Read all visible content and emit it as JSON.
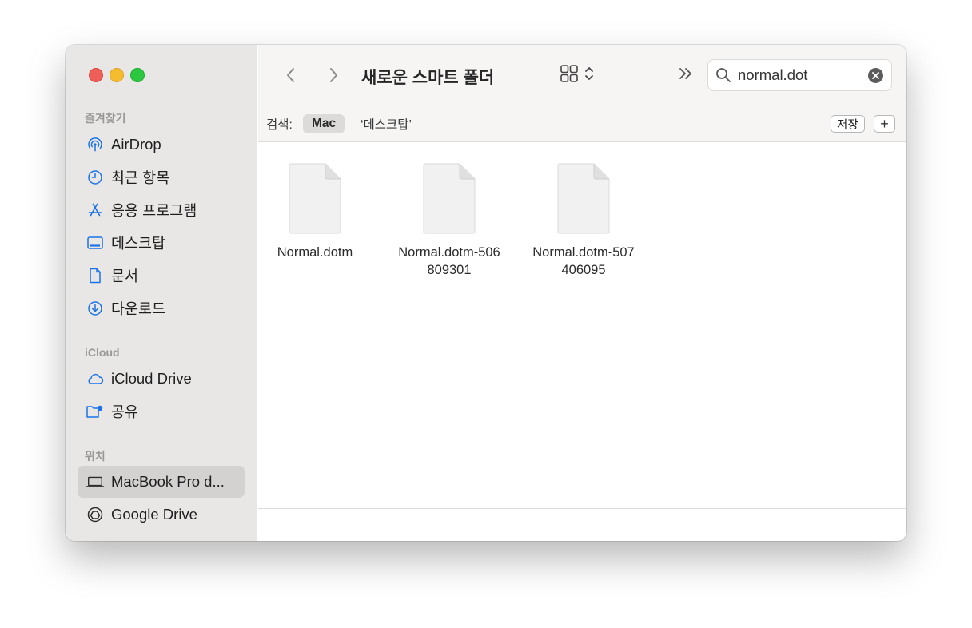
{
  "sidebar": {
    "sections": [
      {
        "header": "즐겨찾기"
      },
      {
        "header": "iCloud"
      },
      {
        "header": "위치"
      }
    ],
    "favorites": [
      {
        "label": "AirDrop",
        "icon": "airdrop-icon"
      },
      {
        "label": "최근 항목",
        "icon": "clock-icon"
      },
      {
        "label": "응용 프로그램",
        "icon": "app-store-icon"
      },
      {
        "label": "데스크탑",
        "icon": "desktop-icon"
      },
      {
        "label": "문서",
        "icon": "document-icon"
      },
      {
        "label": "다운로드",
        "icon": "download-icon"
      }
    ],
    "icloud": [
      {
        "label": "iCloud Drive",
        "icon": "cloud-icon"
      },
      {
        "label": "공유",
        "icon": "shared-folder-icon"
      }
    ],
    "locations": [
      {
        "label": "MacBook Pro d...",
        "icon": "laptop-icon",
        "selected": true
      },
      {
        "label": "Google Drive",
        "icon": "google-drive-icon"
      }
    ]
  },
  "toolbar": {
    "title": "새로운 스마트 폴더",
    "search_value": "normal.dot"
  },
  "scopebar": {
    "label": "검색:",
    "mac": "Mac",
    "desktop": "‘데스크탑’",
    "save": "저장",
    "plus": "+"
  },
  "files": [
    {
      "line1": "Normal.dotm",
      "line2": ""
    },
    {
      "line1": "Normal.dotm-506",
      "line2": "809301"
    },
    {
      "line1": "Normal.dotm-507",
      "line2": "406095"
    }
  ],
  "colors": {
    "accent": "#1a73e8",
    "sidebar_bg": "#e9e7e6",
    "close": "#ee5f57",
    "minimize": "#f5bc2f",
    "zoom": "#2ac73f"
  }
}
